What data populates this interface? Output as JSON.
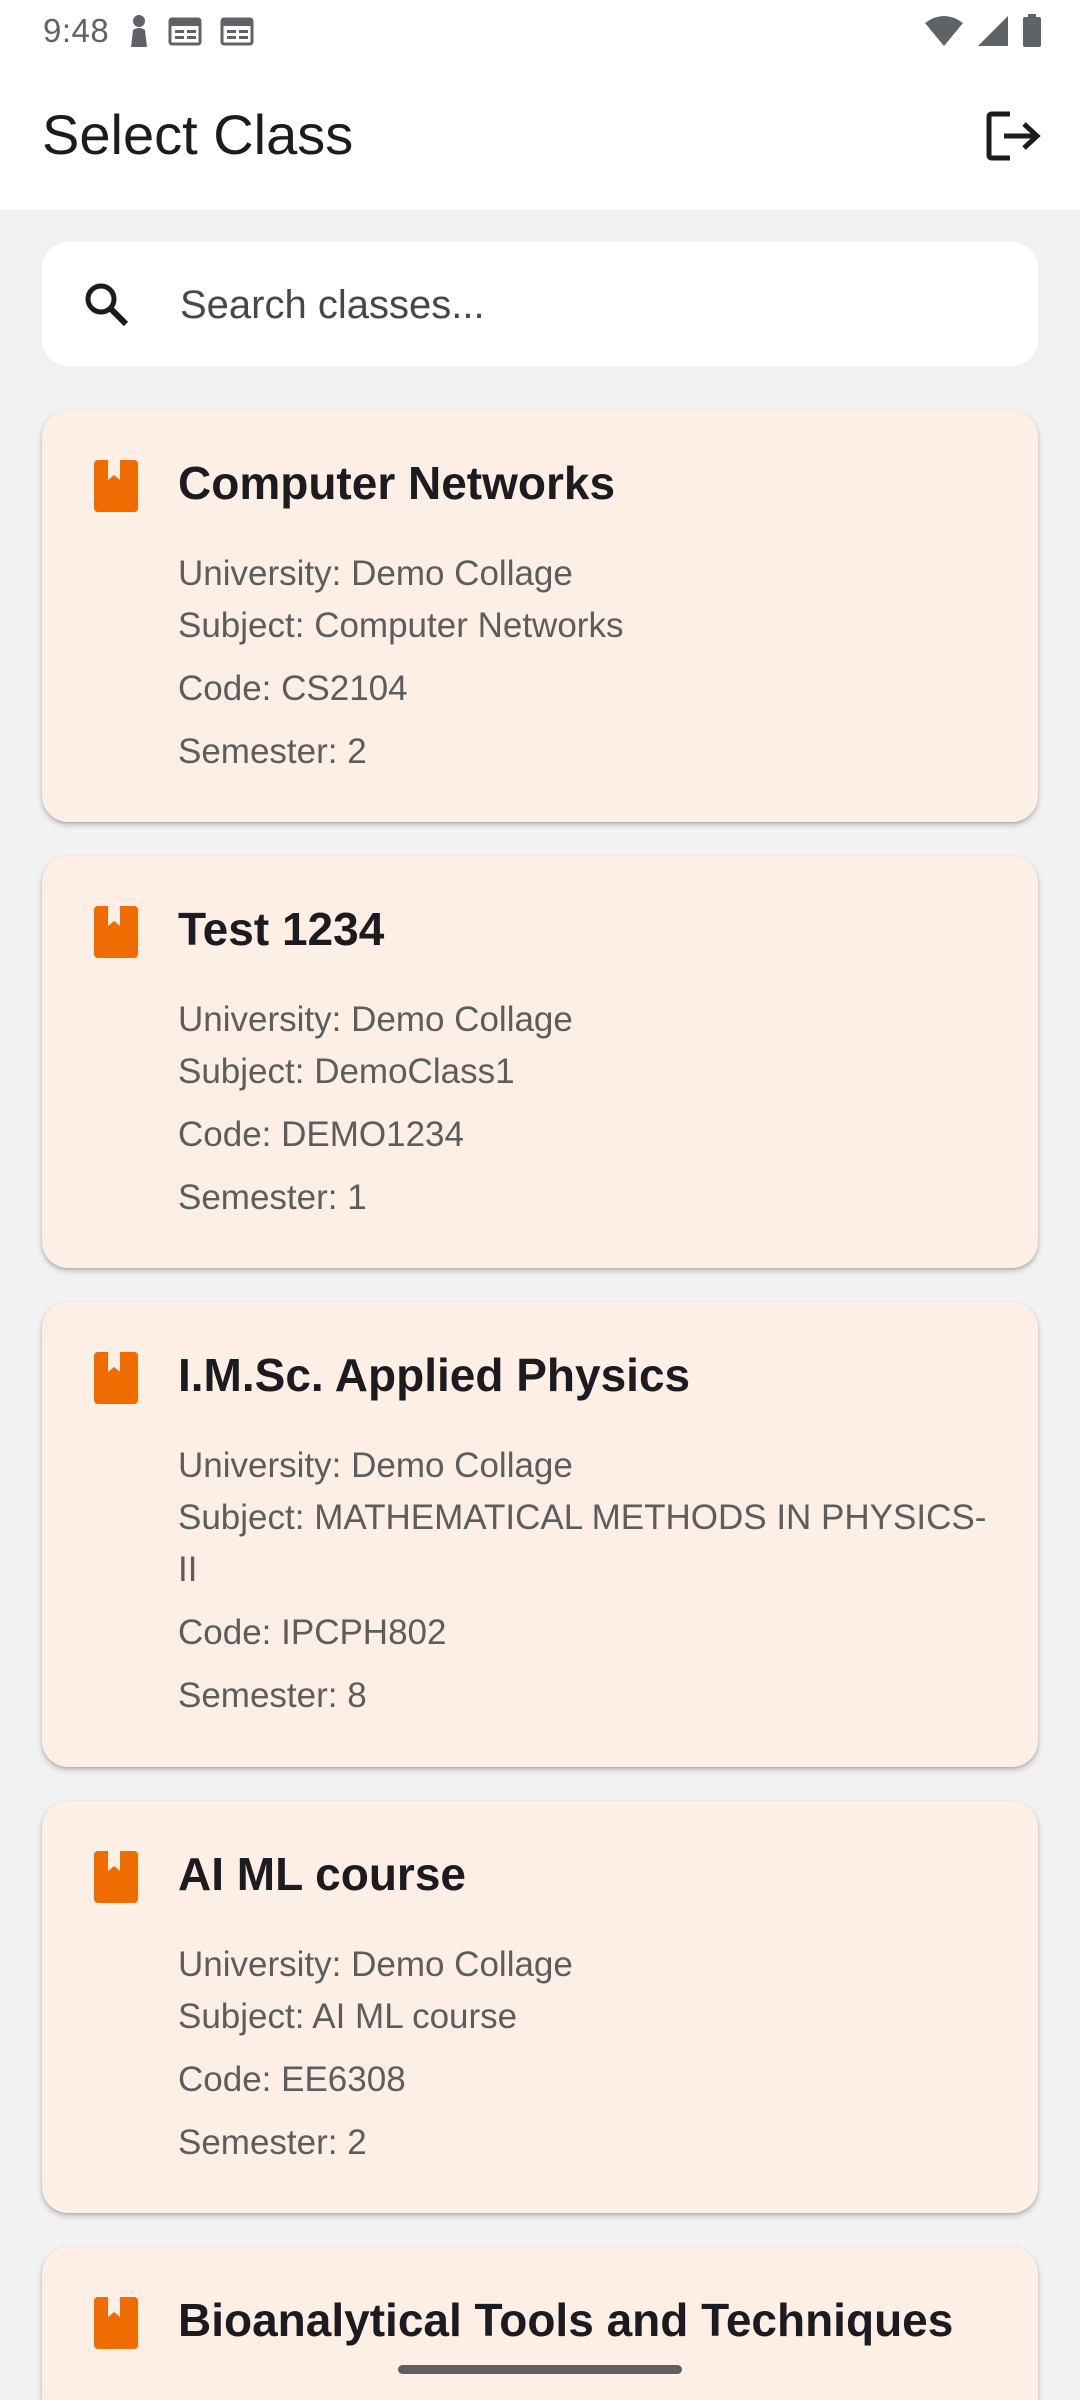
{
  "status_bar": {
    "time": "9:48",
    "left_icons": [
      "person-icon",
      "calendar-icon",
      "calendar-icon"
    ],
    "right_icons": [
      "wifi-icon",
      "signal-icon",
      "battery-icon"
    ]
  },
  "app_bar": {
    "title": "Select Class",
    "action_icon": "logout-icon"
  },
  "search": {
    "placeholder": "Search classes...",
    "value": ""
  },
  "colors": {
    "accent": "#ef6c00",
    "card_bg": "#fdeee6",
    "page_bg": "#f2f2f2"
  },
  "classes": [
    {
      "title": "Computer Networks",
      "university": "University: Demo Collage",
      "subject": "Subject: Computer Networks",
      "code": "Code: CS2104",
      "semester": "Semester: 2"
    },
    {
      "title": "Test 1234",
      "university": "University: Demo Collage",
      "subject": "Subject: DemoClass1",
      "code": "Code: DEMO1234",
      "semester": "Semester: 1"
    },
    {
      "title": "I.M.Sc. Applied Physics",
      "university": "University: Demo Collage",
      "subject": "Subject: MATHEMATICAL METHODS IN PHYSICS-II",
      "code": "Code: IPCPH802",
      "semester": "Semester: 8"
    },
    {
      "title": "AI ML course",
      "university": "University: Demo Collage",
      "subject": "Subject: AI ML course",
      "code": "Code: EE6308",
      "semester": "Semester: 2"
    },
    {
      "title": "Bioanalytical Tools and Techniques"
    }
  ]
}
